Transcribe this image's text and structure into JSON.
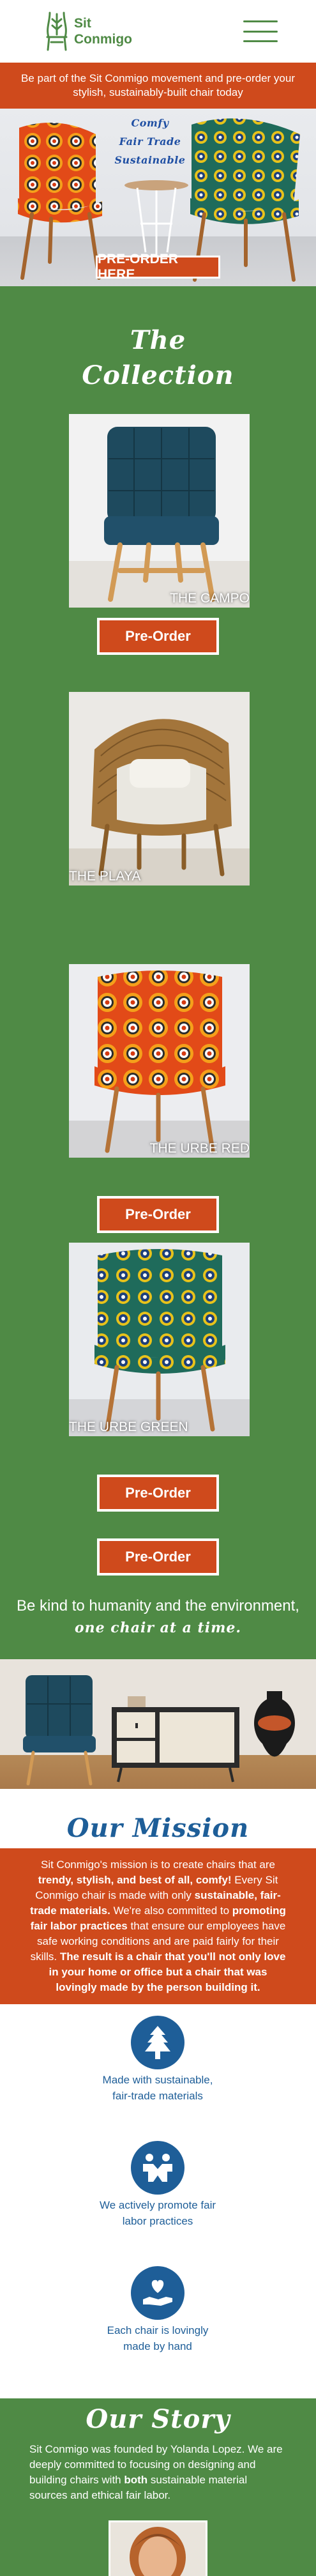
{
  "header": {
    "logo_line1": "Sit",
    "logo_line2": "Conmigo",
    "menu_icon": "hamburger-menu-icon"
  },
  "banner": {
    "text": "Be part of the Sit Conmigo movement and pre-order your stylish, sustainably-built chair today"
  },
  "hero": {
    "tagline": [
      "Comfy",
      "Fair Trade",
      "Sustainable"
    ],
    "cta_label": "PRE-ORDER HERE"
  },
  "collection": {
    "title_line1": "The",
    "title_line2": "Collection",
    "products": [
      {
        "name": "THE CAMPO",
        "button": "Pre-Order"
      },
      {
        "name": "THE PLAYA",
        "button": "Pre-Order"
      },
      {
        "name": "THE URBE RED",
        "button": "Pre-Order"
      },
      {
        "name": "THE URBE GREEN",
        "button": "Pre-Order"
      }
    ],
    "kind_line1": "Be kind to humanity and the environment,",
    "kind_line2": "one chair at a time."
  },
  "mission": {
    "title": "Our Mission",
    "p1": "Sit Conmigo's mission is to create chairs that are ",
    "b1": "trendy, stylish, and best of all, comfy!",
    "p2": " Every Sit Conmigo chair is made with only ",
    "b2": "sustainable, fair-trade materials.",
    "p3": " We're also committed to ",
    "b3": "promoting fair labor practices",
    "p4": " that ensure our employees have safe working conditions and are paid fairly for their skills. ",
    "b4": "The result is a chair that you'll not only love in your home or office but a chair that was lovingly made by the person building it.",
    "features": [
      {
        "icon": "tree-icon",
        "label": "Made with sustainable, fair-trade materials"
      },
      {
        "icon": "handshake-icon",
        "label": "We actively promote fair labor practices"
      },
      {
        "icon": "heart-hand-icon",
        "label": "Each chair is lovingly made by hand"
      }
    ]
  },
  "story": {
    "title": "Our Story",
    "text_before": "Sit Conmigo was founded by Yolanda Lopez. We are deeply committed to focusing on designing and building chairs with ",
    "text_bold": "both",
    "text_after": " sustainable material sources and ethical fair labor."
  },
  "colors": {
    "green": "#4f8a45",
    "orange": "#cf4a1c",
    "blue": "#1e5e98"
  }
}
